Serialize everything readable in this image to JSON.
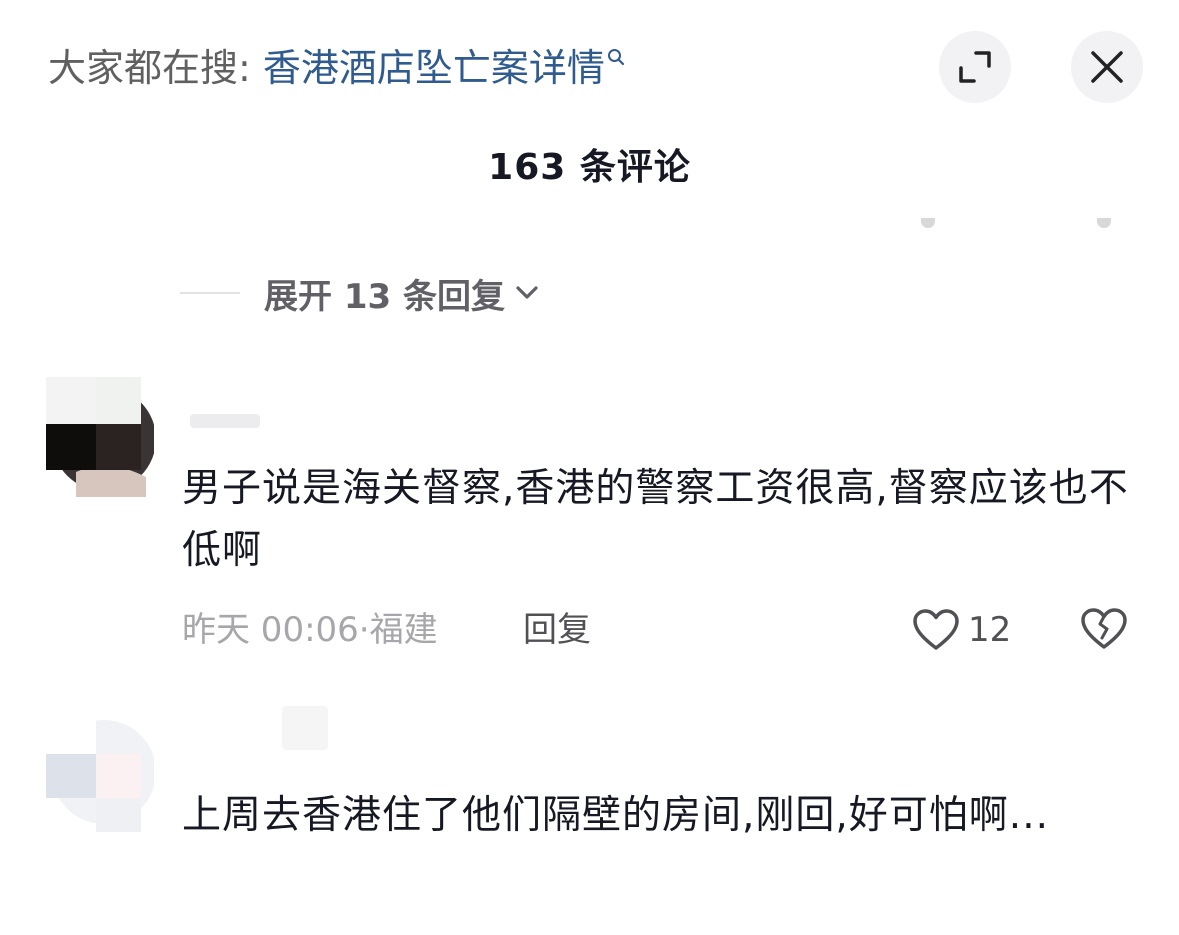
{
  "search": {
    "prefix": "大家都在搜",
    "separator": ":",
    "query": "香港酒店坠亡案详情"
  },
  "header": {
    "comment_count": "163 条评论"
  },
  "thread": {
    "expand_label": "展开 13 条回复"
  },
  "comments": [
    {
      "text": "男子说是海关督察,香港的警察工资很高,督察应该也不低啊",
      "time": "昨天 00:06",
      "separator": "·",
      "location": "福建",
      "reply_label": "回复",
      "likes": "12"
    },
    {
      "text": "上周去香港住了他们隔壁的房间,刚回,好可怕啊..."
    }
  ],
  "icons": {
    "search": "search-icon",
    "expand": "expand-icon",
    "close": "close-icon",
    "chevron": "chevron-down-icon",
    "like": "heart-outline-icon",
    "dislike": "broken-heart-icon"
  },
  "colors": {
    "accent_link": "#2f5b8f",
    "text_primary": "#161823",
    "text_secondary": "#a6a6ab",
    "button_bg": "#f2f2f4"
  }
}
